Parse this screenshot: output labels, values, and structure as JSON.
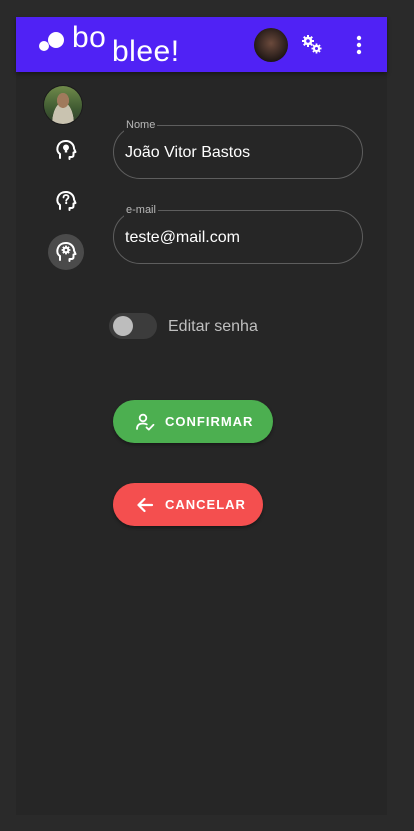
{
  "app": {
    "logo_part1": "bo",
    "logo_part2": "blee!",
    "appbar_color": "#5022f5",
    "icons": {
      "settings": "gears-icon",
      "menu": "more-vert-icon"
    }
  },
  "sidebar": {
    "items": [
      {
        "name": "lightbulb-head-icon"
      },
      {
        "name": "question-head-icon"
      },
      {
        "name": "gear-head-icon",
        "active": true
      }
    ]
  },
  "form": {
    "name_field": {
      "label": "Nome",
      "value": "João Vitor Bastos"
    },
    "email_field": {
      "label": "e-mail",
      "value": "teste@mail.com"
    },
    "password_toggle": {
      "label": "Editar senha",
      "checked": false
    },
    "confirm_label": "CONFIRMAR",
    "cancel_label": "CANCELAR",
    "colors": {
      "confirm": "#4caf50",
      "cancel": "#f44f4f"
    }
  }
}
